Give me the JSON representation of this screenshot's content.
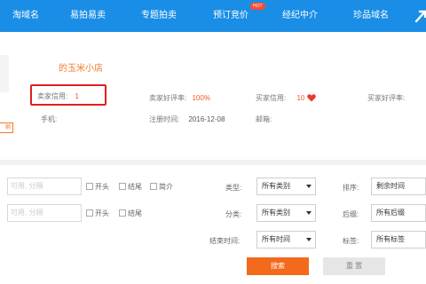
{
  "nav": {
    "items": [
      "淘域名",
      "易拍易卖",
      "专题拍卖",
      "预订竞价",
      "经纪中介",
      "珍品域名"
    ],
    "badge": "HOT",
    "accent": "#1a8ee6"
  },
  "seller": {
    "shop_name": "的玉米小店",
    "tag": "纲",
    "seller_credit_label": "卖家信用:",
    "seller_credit_value": "1",
    "seller_rating_label": "卖家好评率:",
    "seller_rating_value": "100%",
    "buyer_credit_label": "买家信用:",
    "buyer_credit_value": "10",
    "buyer_rating_label": "买家好评率:",
    "phone_label": "手机:",
    "register_label": "注册时间:",
    "register_value": "2016-12-08",
    "email_label": "邮箱:"
  },
  "filters": {
    "search1_placeholder": "可用, 分隔",
    "search2_placeholder": "可用, 分隔",
    "row1_checks": [
      "开头",
      "结尾",
      "简介"
    ],
    "row2_checks": [
      "开头",
      "结尾"
    ],
    "type_label": "类型:",
    "type_value": "所有类别",
    "sort_label": "排序:",
    "sort_value": "剩余时间",
    "category_label": "分类:",
    "category_value": "所有类别",
    "suffix_label": "后缀:",
    "suffix_value": "所有后缀",
    "end_time_label": "结束时间:",
    "end_time_value": "所有时间",
    "tag_label": "标签:",
    "tag_value": "所有标签",
    "search_button": "搜索",
    "reset_button": "重 置"
  },
  "colors": {
    "orange": "#f36a1c",
    "red_box": "#e02020",
    "heart": "#e8392f"
  }
}
